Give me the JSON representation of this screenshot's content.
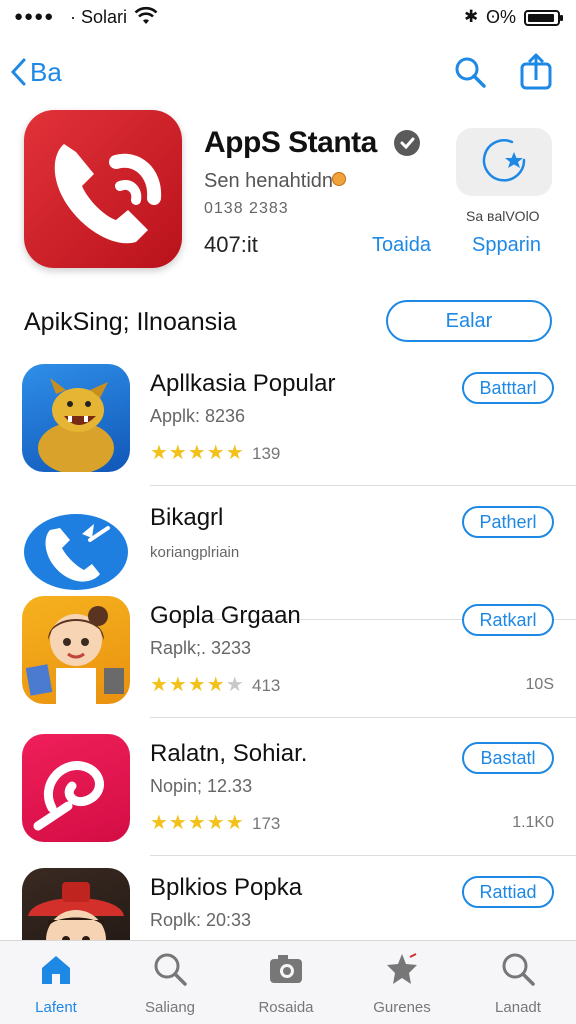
{
  "status_bar": {
    "signal": "●●●●",
    "carrier": "· Solari",
    "battery": "ʘ%"
  },
  "nav": {
    "back_label": "Ba"
  },
  "featured": {
    "title": "AppS Stanta",
    "subtitle": "Sen henahtidn",
    "code": "0138 2383",
    "size": "407:it",
    "link_primary": "Toaida",
    "link_secondary": "Spparin",
    "get_tile_label": "Sa ʙalVOlO",
    "accent_color": "#1e88e5",
    "icon_color": "#d8232a"
  },
  "section": {
    "title": "ApikSing; Ilnoansia",
    "action_label": "Ealar"
  },
  "apps": [
    {
      "name": "Apllkasia Popular",
      "meta": "Applk: 8236",
      "rating": 5,
      "count": "139",
      "side": "",
      "action": "Batttarl",
      "icon": "dog-icon"
    },
    {
      "name": "Bikagrl",
      "meta": "koriangplriain",
      "rating": 0,
      "count": "",
      "side": "",
      "action": "Patherl",
      "icon": "phone-icon"
    },
    {
      "name": "Gopla Grgaan",
      "meta": "Raplk;. 3233",
      "rating": 4,
      "count": "413",
      "side": "10S",
      "action": "Ratkarl",
      "icon": "girl-icon"
    },
    {
      "name": "Ralatn, Sohiar.",
      "meta": "Nopin; 12.33",
      "rating": 5,
      "count": "173",
      "side": "1.1K0",
      "action": "Bastatl",
      "icon": "swirl-icon"
    },
    {
      "name": "Bplkios Popka",
      "meta": "Roplk: 20:33",
      "rating": 0,
      "count": "",
      "side": "",
      "action": "Rattiad",
      "icon": "boy-icon"
    }
  ],
  "tabs": [
    {
      "label": "Lafent",
      "icon": "home-icon",
      "active": true
    },
    {
      "label": "Saliang",
      "icon": "search-icon"
    },
    {
      "label": "Rosaida",
      "icon": "camera-icon"
    },
    {
      "label": "Gurenes",
      "icon": "star-icon"
    },
    {
      "label": "Lanadt",
      "icon": "search-icon"
    }
  ]
}
